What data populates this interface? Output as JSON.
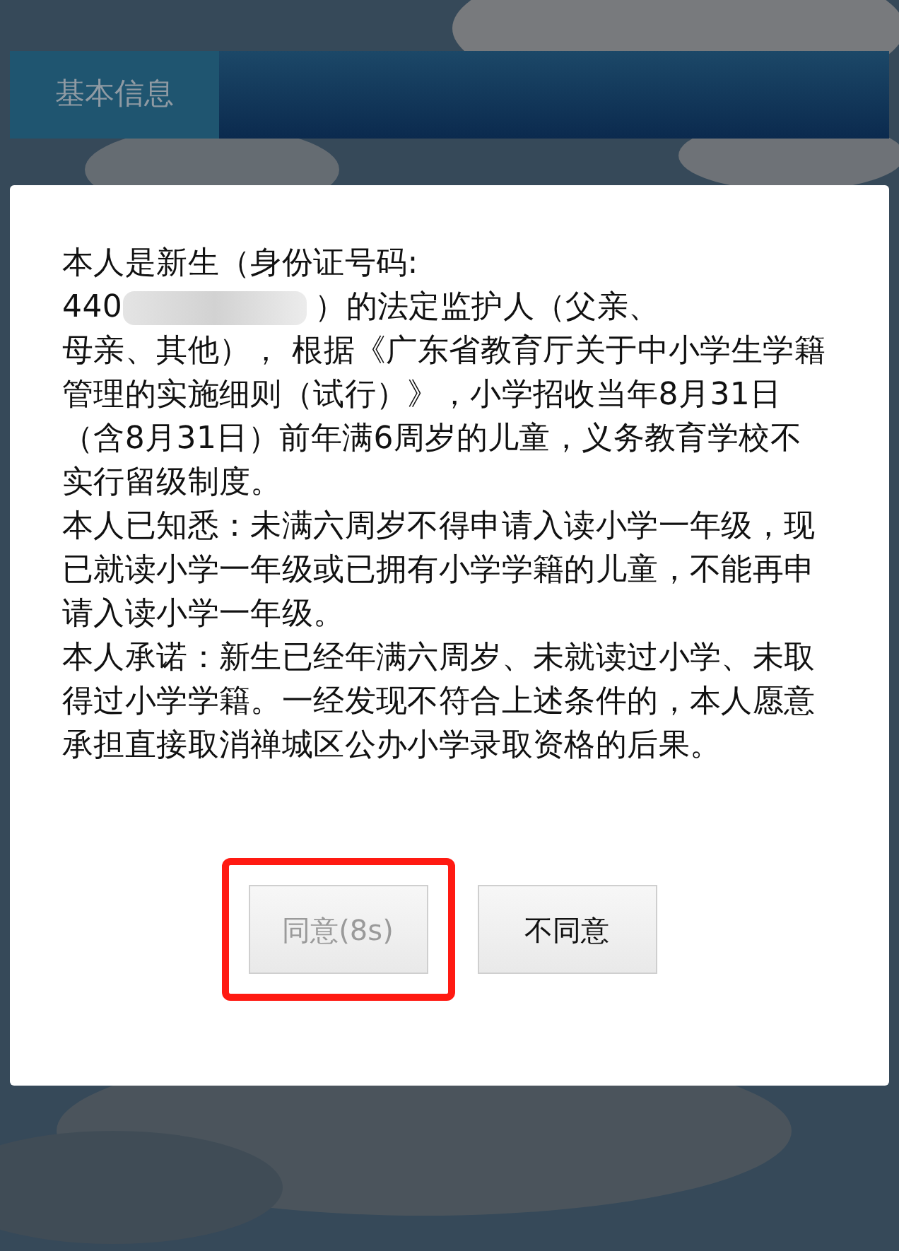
{
  "header": {
    "tab": "基本信息"
  },
  "dialog": {
    "intro": "本人是新生（身份证号码:",
    "id_visible": "440",
    "id_after": "）的法定监护人（父亲、",
    "continuation": "母亲、其他）， 根据《广东省教育厅关于中小学生学籍管理的实施细则（试行）》，小学招收当年8月31日（含8月31日）前年满6周岁的儿童，义务教育学校不实行留级制度。",
    "paragraphs": [
      "本人已知悉：未满六周岁不得申请入读小学一年级，现已就读小学一年级或已拥有小学学籍的儿童，不能再申请入读小学一年级。",
      "本人承诺：新生已经年满六周岁、未就读过小学、未取得过小学学籍。一经发现不符合上述条件的，本人愿意承担直接取消禅城区公办小学录取资格的后果。"
    ],
    "buttons": [
      {
        "label": "同意(8s)",
        "disabled": true,
        "highlighted": true
      },
      {
        "label": "不同意",
        "disabled": false,
        "highlighted": false
      }
    ]
  }
}
